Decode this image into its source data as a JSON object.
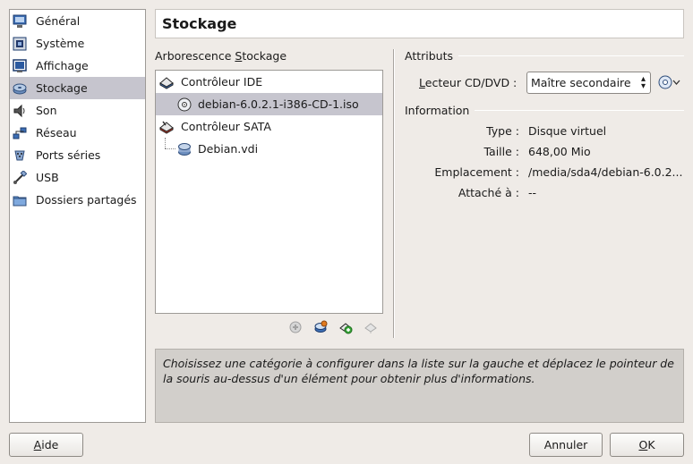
{
  "sidebar": {
    "items": [
      {
        "label": "Général",
        "icon": "monitor-icon"
      },
      {
        "label": "Système",
        "icon": "chip-icon"
      },
      {
        "label": "Affichage",
        "icon": "display-icon"
      },
      {
        "label": "Stockage",
        "icon": "disk-icon",
        "selected": true
      },
      {
        "label": "Son",
        "icon": "speaker-icon"
      },
      {
        "label": "Réseau",
        "icon": "network-icon"
      },
      {
        "label": "Ports séries",
        "icon": "serial-port-icon"
      },
      {
        "label": "USB",
        "icon": "usb-icon"
      },
      {
        "label": "Dossiers partagés",
        "icon": "folder-icon"
      }
    ]
  },
  "header": {
    "title": "Stockage"
  },
  "tree": {
    "label_pre": "Arborescence ",
    "label_accel": "S",
    "label_post": "tockage",
    "rows": [
      {
        "label": "Contrôleur IDE",
        "icon": "ide-controller-icon"
      },
      {
        "label": "debian-6.0.2.1-i386-CD-1.iso",
        "icon": "cd-icon",
        "selected": true
      },
      {
        "label": "Contrôleur SATA",
        "icon": "sata-controller-icon"
      },
      {
        "label": "Debian.vdi",
        "icon": "hard-disk-icon"
      }
    ]
  },
  "attributes": {
    "title": "Attributs",
    "drive_label_accel": "L",
    "drive_label_rest": "ecteur CD/DVD :",
    "drive_value": "Maître secondaire"
  },
  "information": {
    "title": "Information",
    "rows": [
      {
        "key": "Type :",
        "value": "Disque virtuel"
      },
      {
        "key": "Taille :",
        "value": "648,00 Mio"
      },
      {
        "key": "Emplacement :",
        "value": "/media/sda4/debian-6.0.2..."
      },
      {
        "key": "Attaché à :",
        "value": "--"
      }
    ]
  },
  "help_text": "Choisissez une catégorie à configurer dans la liste sur la gauche et déplacez le pointeur de la souris au-dessus d'un élément pour obtenir plus d'informations.",
  "buttons": {
    "help_accel": "A",
    "help_rest": "ide",
    "cancel": "Annuler",
    "ok_accel": "O",
    "ok_rest": "K"
  }
}
